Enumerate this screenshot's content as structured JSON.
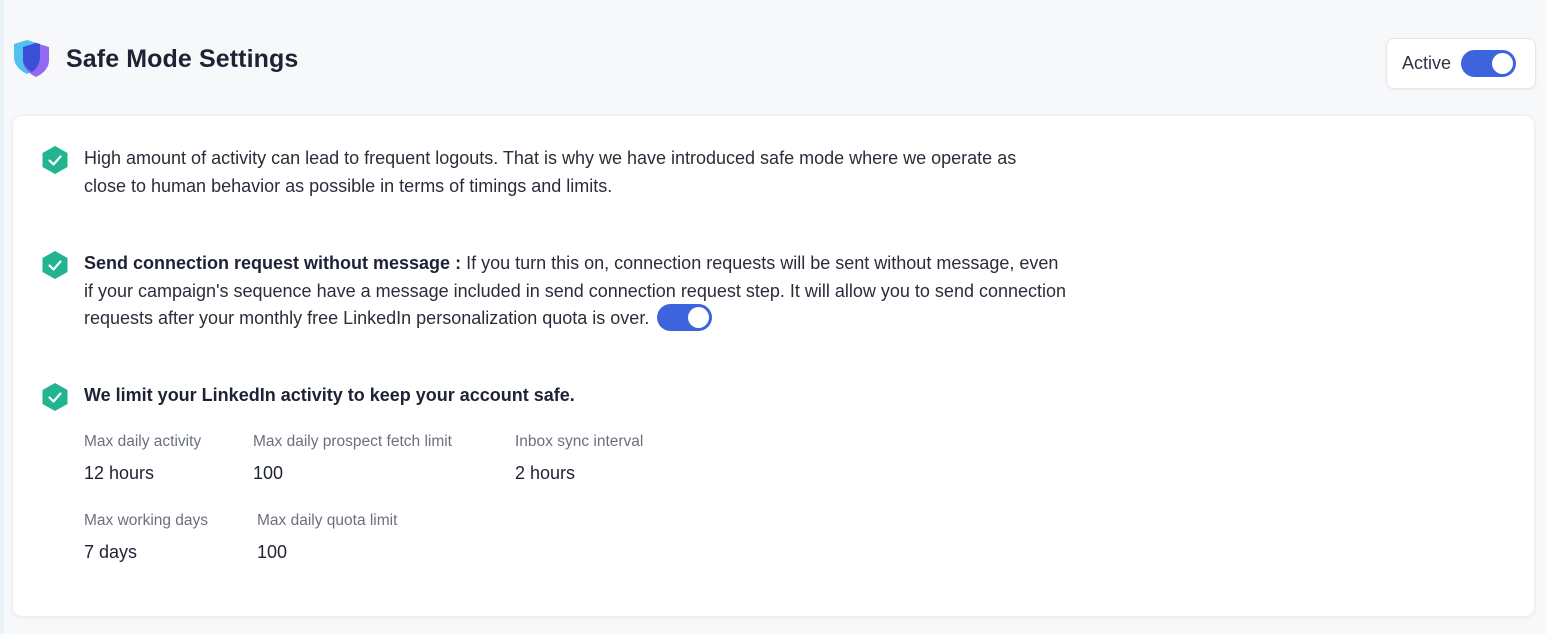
{
  "header": {
    "title": "Safe Mode Settings",
    "active_label": "Active",
    "active_enabled": true
  },
  "sections": {
    "intro": {
      "text": "High amount of activity can lead to frequent logouts. That is why we have introduced safe mode where we operate as close to human behavior as possible in terms of timings and limits."
    },
    "connection": {
      "bold": "Send connection request without message :",
      "text": " If you turn this on, connection requests will be sent without message, even if your campaign's sequence have a message included in send connection request step. It will allow you to send connection requests after your monthly free LinkedIn personalization quota is over.",
      "enabled": true
    },
    "limits": {
      "heading": "We limit your LinkedIn activity to keep your account safe.",
      "stats": [
        {
          "label": "Max daily activity",
          "value": "12 hours"
        },
        {
          "label": "Max daily prospect fetch limit",
          "value": "100"
        },
        {
          "label": "Inbox sync interval",
          "value": "2 hours"
        },
        {
          "label": "Max working days",
          "value": "7 days"
        },
        {
          "label": "Max daily quota limit",
          "value": "100"
        }
      ]
    }
  },
  "colors": {
    "accent": "#3d63dd",
    "check": "#22b391",
    "shield_front": "#8a5cf0",
    "shield_back": "#4fc3f0"
  },
  "icons": {
    "header": "shield-icon",
    "bullet": "check-badge-icon"
  }
}
